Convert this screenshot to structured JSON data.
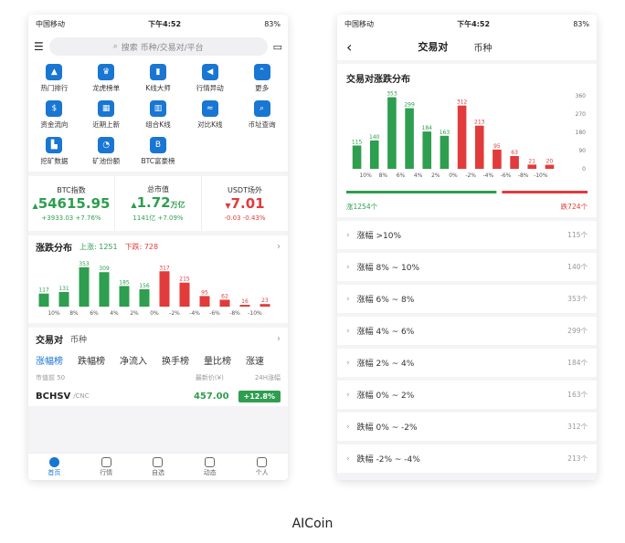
{
  "status": {
    "carrier": "中国移动",
    "time": "下午4:52",
    "battery": "83%"
  },
  "left": {
    "search_placeholder": "搜索 币种/交易对/平台",
    "grid": [
      {
        "label": "热门排行",
        "icon": "flame-icon",
        "glyph": "▲"
      },
      {
        "label": "龙虎榜单",
        "icon": "trophy-icon",
        "glyph": "♛"
      },
      {
        "label": "K线大师",
        "icon": "candlestick-icon",
        "glyph": "▮"
      },
      {
        "label": "行情异动",
        "icon": "megaphone-icon",
        "glyph": "◀"
      },
      {
        "label": "更多",
        "icon": "more-icon",
        "glyph": "⌃"
      },
      {
        "label": "资金流向",
        "icon": "dollar-icon",
        "glyph": "$"
      },
      {
        "label": "近期上新",
        "icon": "calendar-icon",
        "glyph": "▦"
      },
      {
        "label": "组合K线",
        "icon": "combo-chart-icon",
        "glyph": "▥"
      },
      {
        "label": "对比K线",
        "icon": "compare-chart-icon",
        "glyph": "≈"
      },
      {
        "label": "币址查询",
        "icon": "search-doc-icon",
        "glyph": "⌕"
      },
      {
        "label": "挖矿数据",
        "icon": "mining-icon",
        "glyph": "▙"
      },
      {
        "label": "矿池份额",
        "icon": "pie-icon",
        "glyph": "◔"
      },
      {
        "label": "BTC富豪榜",
        "icon": "bitcoin-icon",
        "glyph": "B"
      }
    ],
    "stats": [
      {
        "title": "BTC指数",
        "value": "54615.95",
        "unit": "",
        "sub": "+3933.03  +7.76%",
        "color": "green",
        "arrow": "▲"
      },
      {
        "title": "总市值",
        "value": "1.72",
        "unit": "万亿",
        "sub": "1141亿  +7.09%",
        "color": "green",
        "arrow": "▲"
      },
      {
        "title": "USDT场外",
        "value": "7.01",
        "unit": "",
        "sub": "-0.03  -0.43%",
        "color": "red",
        "arrow": "▼"
      }
    ],
    "dist": {
      "title": "涨跌分布",
      "up": "上涨: 1251",
      "down": "下跌: 728"
    },
    "pair_tabs": {
      "a": "交易对",
      "b": "币种"
    },
    "rank_tabs": [
      "涨幅榜",
      "跌幅榜",
      "净流入",
      "换手榜",
      "量比榜",
      "涨速"
    ],
    "col_headers": {
      "market": "市值前 50",
      "price": "最新价(¥)",
      "change": "24H涨幅"
    },
    "first_row": {
      "symbol": "BCHSV",
      "quote": "/CNC",
      "price": "457.00",
      "change": "+12.8%"
    },
    "nav": [
      "首页",
      "行情",
      "自选",
      "动态",
      "个人"
    ]
  },
  "right": {
    "back": "‹",
    "title": "交易对",
    "tab2": "币种",
    "card_title": "交易对涨跌分布",
    "up_count": "涨1254个",
    "down_count": "跌724个",
    "rows": [
      {
        "label": "涨幅 >10%",
        "count": "115个"
      },
      {
        "label": "涨幅 8% ~ 10%",
        "count": "140个"
      },
      {
        "label": "涨幅 6% ~ 8%",
        "count": "353个"
      },
      {
        "label": "涨幅 4% ~ 6%",
        "count": "299个"
      },
      {
        "label": "涨幅 2% ~ 4%",
        "count": "184个"
      },
      {
        "label": "涨幅 0% ~ 2%",
        "count": "163个"
      },
      {
        "label": "跌幅 0% ~ -2%",
        "count": "312个"
      },
      {
        "label": "跌幅 -2% ~ -4%",
        "count": "213个"
      }
    ]
  },
  "caption": "AICoin",
  "chart_data": [
    {
      "type": "bar",
      "title": "涨跌分布",
      "categories": [
        "10%",
        "8%",
        "6%",
        "4%",
        "2%",
        "0%",
        "-2%",
        "-4%",
        "-6%",
        "-8%",
        "-10%"
      ],
      "values": [
        117,
        131,
        353,
        309,
        185,
        156,
        317,
        215,
        95,
        62,
        16,
        23
      ],
      "note_values_aligned_to_bars": true,
      "colors": {
        "up": "#2e9e4f",
        "down": "#e23b3b"
      },
      "up_bars": 6
    },
    {
      "type": "bar",
      "title": "交易对涨跌分布",
      "categories": [
        "10%",
        "8%",
        "6%",
        "4%",
        "2%",
        "0%",
        "-2%",
        "-4%",
        "-6%",
        "-8%",
        "-10%"
      ],
      "values": [
        115,
        140,
        353,
        299,
        184,
        163,
        312,
        213,
        95,
        63,
        21,
        20
      ],
      "yticks": [
        0,
        90,
        180,
        270,
        360
      ],
      "ylim": [
        0,
        360
      ],
      "colors": {
        "up": "#2e9e4f",
        "down": "#e23b3b"
      },
      "up_bars": 6
    }
  ]
}
